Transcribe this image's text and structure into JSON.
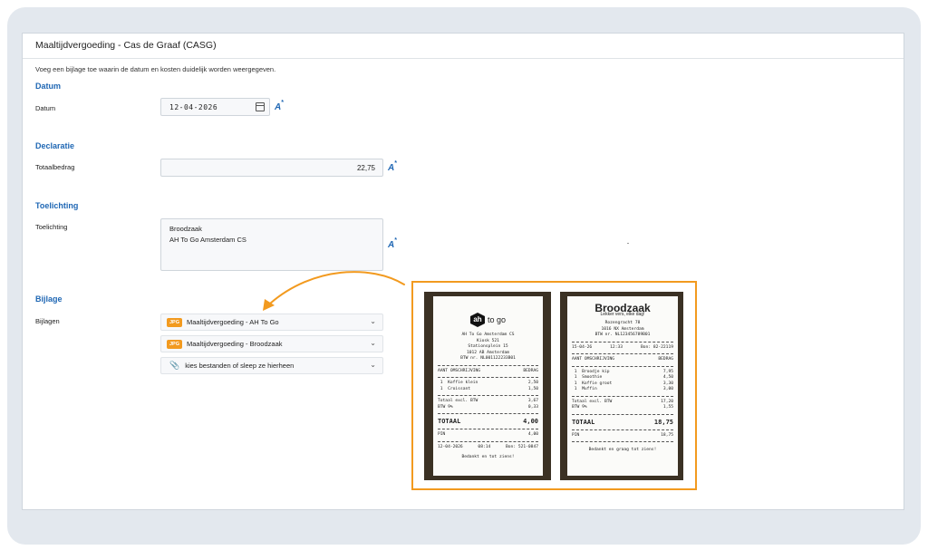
{
  "panel": {
    "title": "Maaltijdvergoeding - Cas de Graaf (CASG)",
    "intro": "Voeg een bijlage toe waarin de datum en kosten duidelijk worden weergegeven."
  },
  "sections": {
    "datum": {
      "title": "Datum",
      "label": "Datum",
      "value": "12-04-2026"
    },
    "declaratie": {
      "title": "Declaratie",
      "label": "Totaalbedrag",
      "value": "22,75"
    },
    "toelichting": {
      "title": "Toelichting",
      "label": "Toelichting",
      "line1": "Broodzaak",
      "line2": "AH To Go Amsterdam CS"
    },
    "bijlage": {
      "title": "Bijlage",
      "label": "Bijlagen",
      "files": [
        {
          "badge": "JPG",
          "name": "Maaltijdvergoeding - AH To Go"
        },
        {
          "badge": "JPG",
          "name": "Maaltijdvergoeding - Broodzaak"
        }
      ],
      "upload_label": "kies bestanden of sleep ze hierheen"
    }
  },
  "receipt_ah": {
    "logo": "ah",
    "brand": "to go",
    "address": [
      "AH To Go Amsterdam CS",
      "Kiosk 521",
      "Stationsplein 15",
      "1012 AB Amsterdam",
      "BTW nr. NL001122233B01"
    ],
    "head_left": "AANT OMSCHRIJVING",
    "head_right": "BEDRAG",
    "items": [
      {
        "q": "1",
        "name": "Koffie klein",
        "price": "2,50"
      },
      {
        "q": "1",
        "name": "Croissant",
        "price": "1,50"
      }
    ],
    "excl_label": "Totaal excl. BTW",
    "excl": "3,67",
    "btw_label": "BTW 9%",
    "btw": "0,33",
    "total_label": "TOTAAL",
    "total": "4,00",
    "pin_label": "PIN",
    "pin": "4,00",
    "date": "12-04-2026",
    "time": "08:14",
    "bon": "Bon: 521-0847",
    "thanks": "Bedankt en tot ziens!"
  },
  "receipt_bz": {
    "title": "Broodzaak",
    "subtitle": "Lekker vers, elke dag!",
    "address": [
      "Rozengracht 78",
      "1016 NX Amsterdam",
      "BTW nr. NL123456789B01"
    ],
    "date": "15-04-26",
    "time": "12:33",
    "bon": "Bon: 82-22119",
    "head_left": "AANT OMSCHRIJVING",
    "head_right": "BEDRAG",
    "items": [
      {
        "q": "1",
        "name": "Broodje kip",
        "price": "7,95"
      },
      {
        "q": "1",
        "name": "Smoothie",
        "price": "4,50"
      },
      {
        "q": "1",
        "name": "Koffie groot",
        "price": "3,30"
      },
      {
        "q": "1",
        "name": "Muffin",
        "price": "3,00"
      }
    ],
    "excl_label": "Totaal excl. BTW",
    "excl": "17,20",
    "btw_label": "BTW 9%",
    "btw": "1,55",
    "total_label": "TOTAAL",
    "total": "18,75",
    "pin_label": "PIN",
    "pin": "18,75",
    "thanks": "Bedankt en graag tot ziens!"
  },
  "colors": {
    "accent": "#1f67b4",
    "highlight": "#f29a1f",
    "frame": "#e3e8ee"
  },
  "icons": {
    "date_picker": "calendar-icon",
    "ai": "ai-sparkle-icon",
    "attach": "paperclip-icon",
    "expand": "chevron-down-icon"
  }
}
